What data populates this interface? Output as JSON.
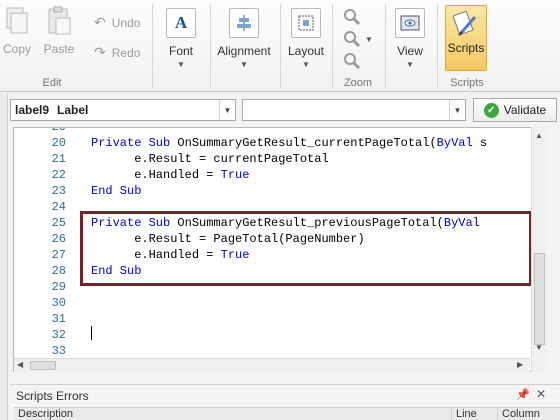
{
  "ribbon": {
    "edit": {
      "copy": "Copy",
      "paste": "Paste",
      "undo": "Undo",
      "redo": "Redo",
      "group": "Edit"
    },
    "font": "Font",
    "alignment": "Alignment",
    "layout": "Layout",
    "zoom_group": "Zoom",
    "view": "View",
    "scripts": "Scripts",
    "scripts_group": "Scripts"
  },
  "selector": {
    "component": "label9",
    "component_type": "Label",
    "event": "",
    "validate": "Validate"
  },
  "editor": {
    "line_numbers": [
      "20",
      "21",
      "22",
      "23",
      "24",
      "25",
      "26",
      "27",
      "28",
      "29",
      "30",
      "31",
      "32",
      "33"
    ],
    "lines": [
      {
        "kw1": "Private Sub ",
        "text": "OnSummaryGetResult_currentPageTotal(",
        "kw2": "ByVal",
        "rest": " s"
      },
      {
        "kw1": "",
        "text": "      e.Result = currentPageTotal",
        "kw2": "",
        "rest": ""
      },
      {
        "kw1": "",
        "text": "      e.Handled = ",
        "kw2": "True",
        "rest": ""
      },
      {
        "kw1": "End Sub",
        "text": "",
        "kw2": "",
        "rest": ""
      },
      {
        "kw1": "",
        "text": "",
        "kw2": "",
        "rest": ""
      },
      {
        "kw1": "Private Sub ",
        "text": "OnSummaryGetResult_previousPageTotal(",
        "kw2": "ByVal",
        "rest": ""
      },
      {
        "kw1": "",
        "text": "      e.Result = PageTotal(PageNumber)",
        "kw2": "",
        "rest": ""
      },
      {
        "kw1": "",
        "text": "      e.Handled = ",
        "kw2": "True",
        "rest": ""
      },
      {
        "kw1": "End Sub",
        "text": "",
        "kw2": "",
        "rest": ""
      }
    ]
  },
  "errors_panel": {
    "title": "Scripts Errors",
    "columns": [
      "Description",
      "Line",
      "Column"
    ]
  },
  "colors": {
    "keyword": "#0000d0",
    "line_number": "#2b6ea0",
    "highlight_border": "#7a1e28",
    "scripts_active": "#f5c860"
  }
}
